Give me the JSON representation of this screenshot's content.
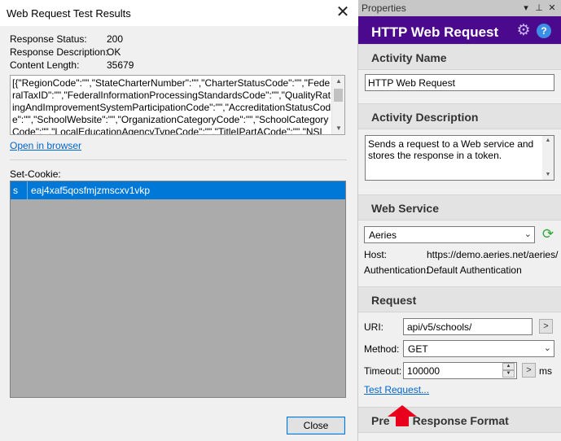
{
  "dialog": {
    "title": "Web Request Test Results",
    "close_glyph": "✕",
    "status_label": "Response Status:",
    "status_value": "200",
    "description_label": "Response Description:",
    "description_value": "OK",
    "length_label": "Content Length:",
    "length_value": "35679",
    "body_text": "[{\"RegionCode\":\"\",\"StateCharterNumber\":\"\",\"CharterStatusCode\":\"\",\"FederalTaxID\":\"\",\"FederalInformationProcessingStandardsCode\":\"\",\"QualityRatingAndImprovementSystemParticipationCode\":\"\",\"AccreditationStatusCode\":\"\",\"SchoolWebsite\":\"\",\"OrganizationCategoryCode\":\"\",\"SchoolCategoryCode\":\"\",\"LocalEducationAgencyTypeCode\":\"\",\"TitleIPartACode\":\"\",\"NSLPStatusCode\":\"\",\"NCESSchoolID\":\"\",\"CollegeBoardSchoolCode\":\"\",\"CensusEnrollmentTypeCode\":\"\",\"RedSch",
    "open_in_browser": "Open in browser",
    "set_cookie_label": "Set-Cookie:",
    "cookies": [
      {
        "name": "s",
        "value": "eaj4xaf5qosfmjzmscxv1vkp"
      }
    ],
    "close_button": "Close"
  },
  "properties": {
    "title": "Properties",
    "header_title": "HTTP Web Request",
    "sections": {
      "activity_name": "Activity Name",
      "activity_description": "Activity Description",
      "web_service": "Web Service",
      "request": "Request",
      "response_format": "Response Format",
      "response_format_prefix": "Pre"
    },
    "activity_name_value": "HTTP Web Request",
    "activity_description_value": "Sends a request to a Web service and stores the response in a token.",
    "web_service_selected": "Aeries",
    "host_label": "Host:",
    "host_value": "https://demo.aeries.net/aeries/",
    "auth_label": "Authentication:",
    "auth_value": "Default Authentication",
    "uri_label": "URI:",
    "uri_value": "api/v5/schools/",
    "method_label": "Method:",
    "method_value": "GET",
    "timeout_label": "Timeout:",
    "timeout_value": "100000",
    "ms_label": "ms",
    "small_button_label": ">",
    "test_request": "Test Request..."
  },
  "colors": {
    "header_purple": "#4b0a8d",
    "selection_blue": "#0078d7",
    "link_blue": "#0066cc",
    "arrow_red": "#e8001c"
  }
}
